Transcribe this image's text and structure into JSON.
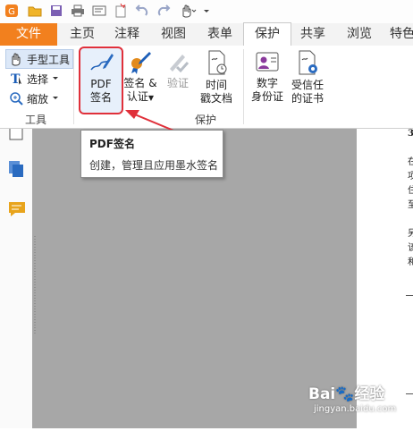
{
  "tabs": [
    "文件",
    "主页",
    "注释",
    "视图",
    "表单",
    "保护",
    "共享",
    "浏览",
    "特色"
  ],
  "active_tab": "保护",
  "tools_group": {
    "hand_tool": "手型工具",
    "select": "选择",
    "zoom": "缩放",
    "label": "工具"
  },
  "protect_group": {
    "pdf_sign_line1": "PDF",
    "pdf_sign_line2": "签名",
    "sign_certify_line1": "签名 &",
    "sign_certify_line2": "认证",
    "verify": "验证",
    "timestamp_line1": "时间",
    "timestamp_line2": "戳文档",
    "label": "保护"
  },
  "trust_group": {
    "digital_id_line1": "数字",
    "digital_id_line2": "身份证",
    "trusted_cert_line1": "受信任",
    "trusted_cert_line2": "的证书"
  },
  "tooltip": {
    "title": "PDF签名",
    "desc": "创建，管理且应用墨水签名"
  },
  "page_text": [
    "3.",
    "在",
    "项",
    "住",
    "至",
    "另",
    "该",
    "和"
  ],
  "watermark": {
    "brand": "Bai",
    "brand2": "经验",
    "url": "jingyan.baidu.com"
  },
  "colors": {
    "file_tab": "#f2801e",
    "highlight_border": "#e0303a",
    "canvas": "#a7a7a7"
  }
}
